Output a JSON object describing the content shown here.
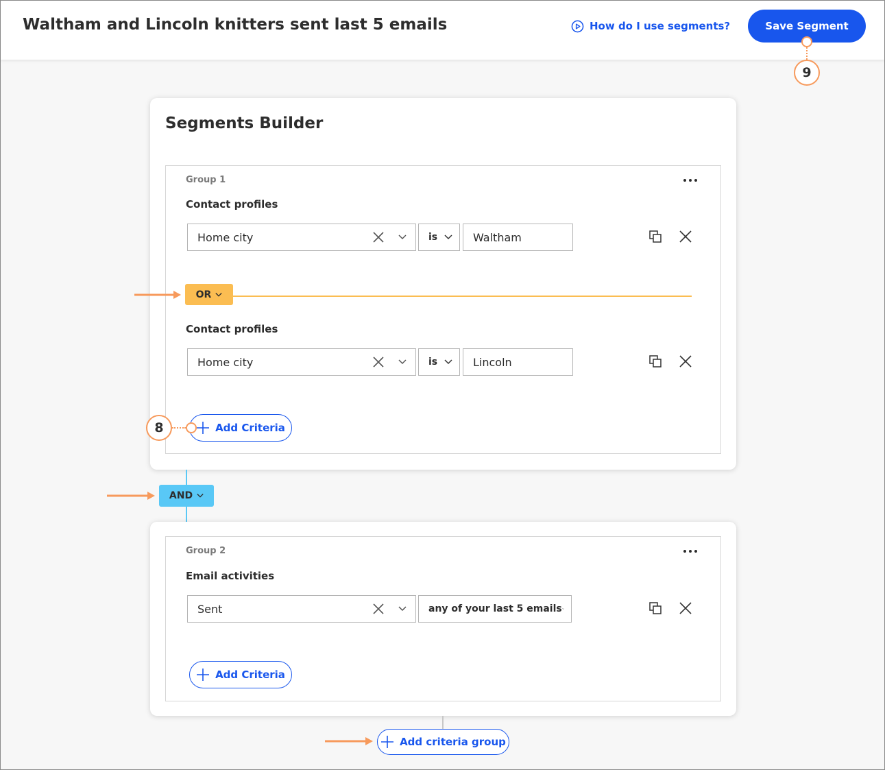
{
  "header": {
    "title": "Waltham and Lincoln knitters sent last 5 emails",
    "help_link": "How do I use segments?",
    "save_label": "Save Segment"
  },
  "builder": {
    "title": "Segments Builder"
  },
  "group1": {
    "label": "Group 1",
    "criteria": [
      {
        "section": "Contact profiles",
        "field": "Home city",
        "operator": "is",
        "value": "Waltham"
      },
      {
        "section": "Contact profiles",
        "field": "Home city",
        "operator": "is",
        "value": "Lincoln"
      }
    ],
    "connector": "OR",
    "add_label": "Add Criteria"
  },
  "group_connector": "AND",
  "group2": {
    "label": "Group 2",
    "criteria": [
      {
        "section": "Email activities",
        "field": "Sent",
        "operator": "any of your last 5 emails"
      }
    ],
    "add_label": "Add Criteria"
  },
  "add_group_label": "Add criteria group",
  "callouts": {
    "add_criteria": "8",
    "save": "9"
  },
  "colors": {
    "accent_blue": "#1856ed",
    "or_yellow": "#fbbd52",
    "and_blue": "#59c8f6",
    "annotation_orange": "#f79a5c"
  },
  "icons": [
    "play-circle-icon",
    "clear-x-icon",
    "chevron-down-icon",
    "duplicate-icon",
    "close-icon",
    "plus-icon",
    "more-horizontal-icon",
    "arrow-right-icon"
  ]
}
